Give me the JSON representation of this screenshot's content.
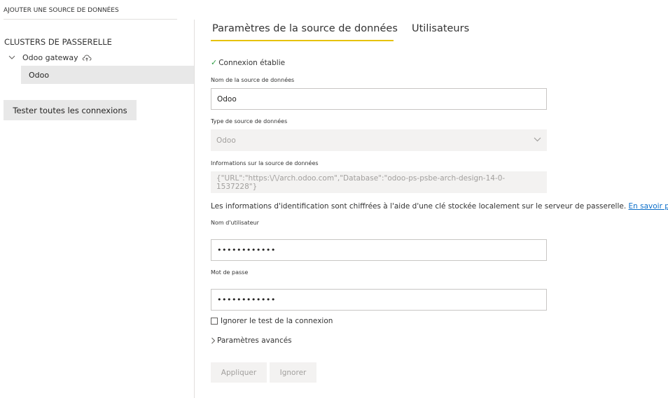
{
  "sidebar": {
    "add_source_title": "AJOUTER UNE SOURCE DE DONNÉES",
    "clusters_heading": "CLUSTERS DE PASSERELLE",
    "gateway_label": "Odoo gateway",
    "datasource_label": "Odoo",
    "test_all_button": "Tester toutes les connexions"
  },
  "tabs": {
    "params_label": "Paramètres de la source de données",
    "users_label": "Utilisateurs",
    "active": "params"
  },
  "form": {
    "connection_status": "Connexion établie",
    "name_label": "Nom de la source de données",
    "name_value": "Odoo",
    "type_label": "Type de source de données",
    "type_value": "Odoo",
    "info_label": "Informations sur la source de données",
    "info_value": "{\"URL\":\"https:\\/\\/arch.odoo.com\",\"Database\":\"odoo-ps-psbe-arch-design-14-0-1537228\"}",
    "credentials_note": "Les informations d'identification sont chiffrées à l'aide d'une clé stockée localement sur le serveur de passerelle.",
    "learn_more": "En savoir plus",
    "username_label": "Nom d'utilisateur",
    "username_value": "••••••••••••",
    "password_label": "Mot de passe",
    "password_value": "••••••••••••",
    "skip_test_label": "Ignorer le test de la connexion",
    "skip_test_checked": false,
    "advanced_label": "Paramètres avancés",
    "apply_button": "Appliquer",
    "ignore_button": "Ignorer"
  },
  "colors": {
    "tab_underline": "#e6c200",
    "link": "#0b6ec9",
    "success": "#2f9e44"
  }
}
